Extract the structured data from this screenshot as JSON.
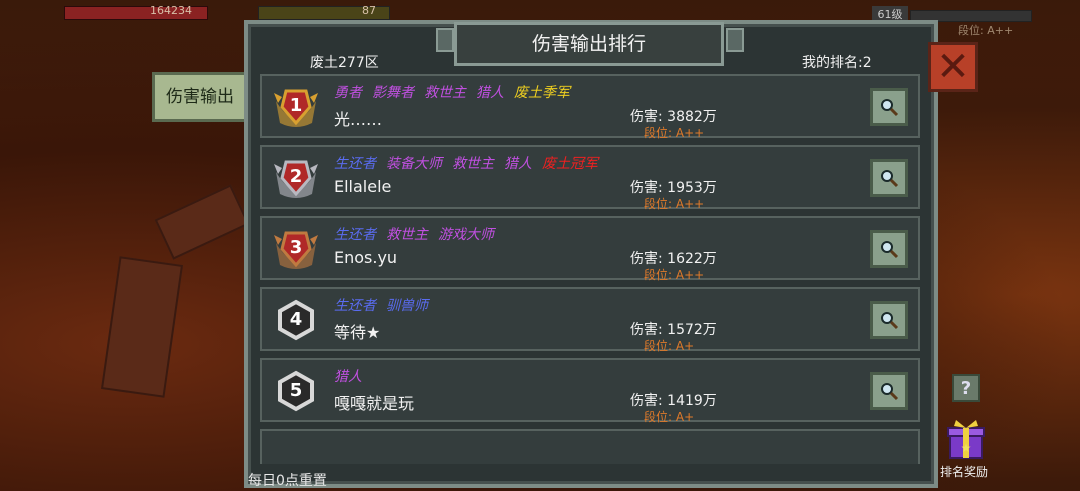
{
  "hud": {
    "hp_value": "164234",
    "bar2_value": "87",
    "level": "61级",
    "faint_rank": "段位: A++"
  },
  "side_tab": {
    "label": "伤害输出"
  },
  "panel": {
    "title": "伤害输出排行",
    "server": "废土277区",
    "my_rank": "我的排名:2"
  },
  "rows": [
    {
      "rank": "1",
      "titles": [
        {
          "text": "勇者",
          "color": "#c050e0"
        },
        {
          "text": "影舞者",
          "color": "#c050e0"
        },
        {
          "text": "救世主",
          "color": "#c050e0"
        },
        {
          "text": "猎人",
          "color": "#c050e0"
        },
        {
          "text": "废土季军",
          "color": "#f0d020"
        }
      ],
      "name": "光……",
      "damage": "伤害: 3882万",
      "tier": "段位: A++"
    },
    {
      "rank": "2",
      "titles": [
        {
          "text": "生还者",
          "color": "#5a6cf0"
        },
        {
          "text": "装备大师",
          "color": "#c050e0"
        },
        {
          "text": "救世主",
          "color": "#c050e0"
        },
        {
          "text": "猎人",
          "color": "#c050e0"
        },
        {
          "text": "废土冠军",
          "color": "#f02020"
        }
      ],
      "name": "Ellalele",
      "damage": "伤害: 1953万",
      "tier": "段位: A++"
    },
    {
      "rank": "3",
      "titles": [
        {
          "text": "生还者",
          "color": "#5a6cf0"
        },
        {
          "text": "救世主",
          "color": "#c050e0"
        },
        {
          "text": "游戏大师",
          "color": "#c050e0"
        }
      ],
      "name": "Enos.yu",
      "damage": "伤害: 1622万",
      "tier": "段位: A++"
    },
    {
      "rank": "4",
      "titles": [
        {
          "text": "生还者",
          "color": "#5a6cf0"
        },
        {
          "text": "驯兽师",
          "color": "#5a6cf0"
        }
      ],
      "name": "等待★",
      "damage": "伤害: 1572万",
      "tier": "段位: A+"
    },
    {
      "rank": "5",
      "titles": [
        {
          "text": "猎人",
          "color": "#c050e0"
        }
      ],
      "name": "嘎嘎就是玩",
      "damage": "伤害: 1419万",
      "tier": "段位: A+"
    }
  ],
  "footer": {
    "reset_note": "每日0点重置",
    "reward_label": "排名奖励",
    "help_glyph": "?"
  },
  "colors": {
    "tier": "#e07a2a",
    "close_bg": "#b84028",
    "panel_border": "#7d8c86"
  }
}
